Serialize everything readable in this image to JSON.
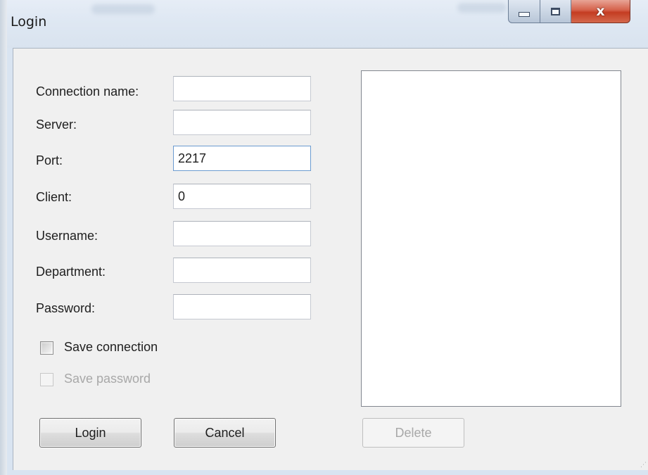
{
  "window": {
    "title": "Login",
    "close_glyph": "x",
    "icons": [
      "minimize-icon",
      "maximize-icon",
      "close-icon"
    ]
  },
  "form": {
    "fields": [
      {
        "label": "Connection name:",
        "value": ""
      },
      {
        "label": "Server:",
        "value": ""
      },
      {
        "label": "Port:",
        "value": "2217"
      },
      {
        "label": "Client:",
        "value": "0"
      },
      {
        "label": "Username:",
        "value": ""
      },
      {
        "label": "Department:",
        "value": ""
      },
      {
        "label": "Password:",
        "value": ""
      }
    ],
    "save_connection": {
      "label": "Save connection",
      "checked": false,
      "enabled": true
    },
    "save_password": {
      "label": "Save password",
      "checked": false,
      "enabled": false
    }
  },
  "buttons": {
    "login": "Login",
    "cancel": "Cancel",
    "delete": "Delete"
  },
  "colors": {
    "close_button": "#c43c22",
    "focused_border": "#6b9bd0",
    "disabled_text": "#a8a8a8"
  }
}
